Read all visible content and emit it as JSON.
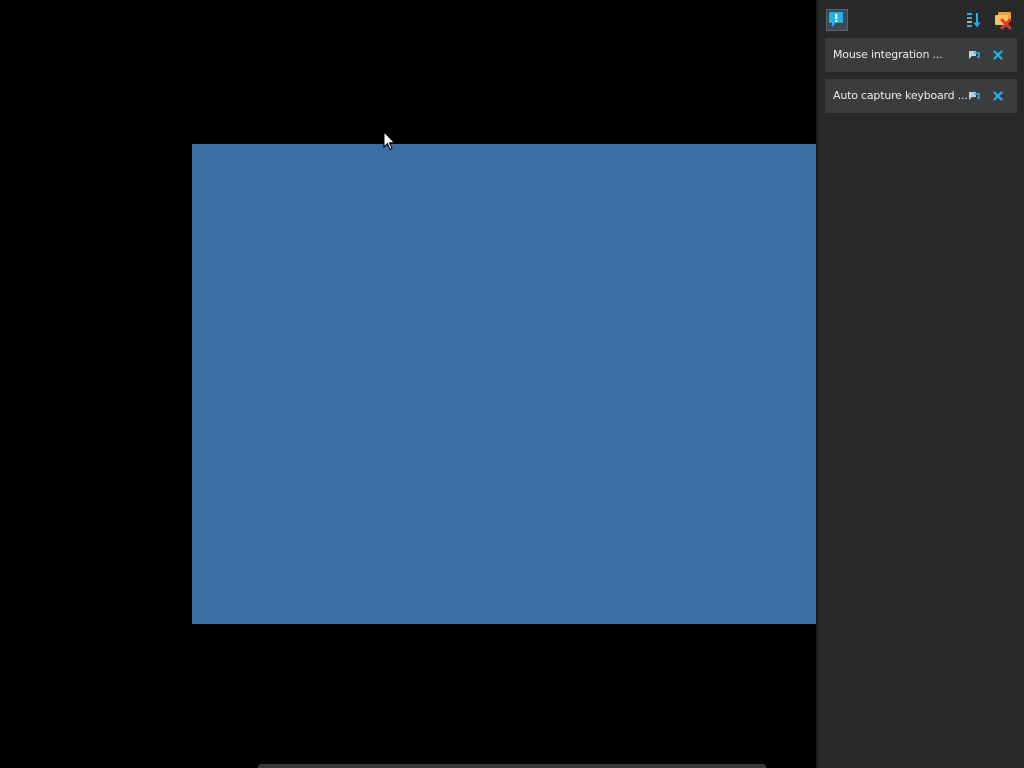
{
  "guest_screen": {
    "color": "#3d6da5"
  },
  "toolbar": {
    "icons": [
      "info-icon",
      "sort-icon",
      "clear-all-icon"
    ],
    "accent": "#1fb3ec"
  },
  "notifications": [
    {
      "text": "Mouse integration ...",
      "actions": [
        "pin-icon",
        "close-icon"
      ]
    },
    {
      "text": "Auto capture keyboard ...",
      "actions": [
        "pin-icon",
        "close-icon"
      ]
    }
  ]
}
